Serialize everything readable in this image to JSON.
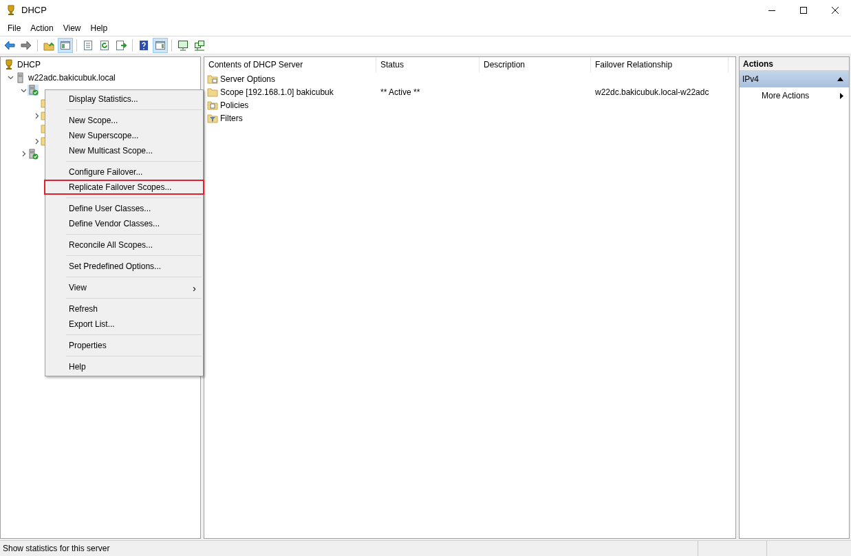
{
  "window": {
    "title": "DHCP"
  },
  "menu_bar": [
    "File",
    "Action",
    "View",
    "Help"
  ],
  "toolbar": [
    [
      {
        "kind": "back",
        "pressed": false
      },
      {
        "kind": "forward",
        "pressed": false
      }
    ],
    [
      {
        "kind": "up",
        "pressed": false
      },
      {
        "kind": "tree",
        "pressed": true
      }
    ],
    [
      {
        "kind": "properties",
        "pressed": false
      },
      {
        "kind": "refresh",
        "pressed": false
      },
      {
        "kind": "export",
        "pressed": false
      }
    ],
    [
      {
        "kind": "help",
        "pressed": false
      },
      {
        "kind": "pane",
        "pressed": true
      }
    ],
    [
      {
        "kind": "monitor",
        "pressed": false
      },
      {
        "kind": "network",
        "pressed": false
      }
    ]
  ],
  "tree": [
    {
      "label": "DHCP",
      "kind": "root",
      "children": [
        {
          "label": "w22adc.bakicubuk.local",
          "kind": "server",
          "expanded": true,
          "children": [
            {
              "kind": "protocol",
              "expanded": true,
              "selected": true,
              "children": [
                {
                  "kind": "folder"
                },
                {
                  "kind": "folder",
                  "expanded": false
                },
                {
                  "kind": "folder"
                },
                {
                  "kind": "folder",
                  "expanded": false
                }
              ]
            },
            {
              "kind": "protocol",
              "expanded": false,
              "selected": false
            }
          ]
        }
      ]
    }
  ],
  "context_menu": [
    [
      {
        "label": "Display Statistics...",
        "highlighted": false
      }
    ],
    [
      {
        "label": "New Scope...",
        "highlighted": false
      },
      {
        "label": "New Superscope...",
        "highlighted": false
      },
      {
        "label": "New Multicast Scope...",
        "highlighted": false
      }
    ],
    [
      {
        "label": "Configure Failover...",
        "highlighted": false
      },
      {
        "label": "Replicate Failover Scopes...",
        "highlighted": true
      }
    ],
    [
      {
        "label": "Define User Classes...",
        "highlighted": false
      },
      {
        "label": "Define Vendor Classes...",
        "highlighted": false
      }
    ],
    [
      {
        "label": "Reconcile All Scopes...",
        "highlighted": false
      }
    ],
    [
      {
        "label": "Set Predefined Options...",
        "highlighted": false
      }
    ],
    [
      {
        "label": "View",
        "highlighted": false,
        "submenu": "›"
      }
    ],
    [
      {
        "label": "Refresh",
        "highlighted": false
      },
      {
        "label": "Export List...",
        "highlighted": false
      }
    ],
    [
      {
        "label": "Properties",
        "highlighted": false
      }
    ],
    [
      {
        "label": "Help",
        "highlighted": false
      }
    ]
  ],
  "table": {
    "columns": [
      "Contents of DHCP Server",
      "Status",
      "Description",
      "Failover Relationship"
    ],
    "rows": [
      {
        "kind": "options",
        "cells": [
          "Server Options",
          "",
          "",
          ""
        ]
      },
      {
        "kind": "folder",
        "cells": [
          "Scope [192.168.1.0] bakicubuk",
          "** Active **",
          "",
          "w22dc.bakicubuk.local-w22adc"
        ]
      },
      {
        "kind": "policies",
        "cells": [
          "Policies",
          "",
          "",
          ""
        ]
      },
      {
        "kind": "filters",
        "cells": [
          "Filters",
          "",
          "",
          ""
        ]
      }
    ]
  },
  "actions": {
    "title": "Actions",
    "section": "IPv4",
    "expanded": true,
    "items": [
      "More Actions"
    ]
  },
  "status_bar": "Show statistics for this server"
}
